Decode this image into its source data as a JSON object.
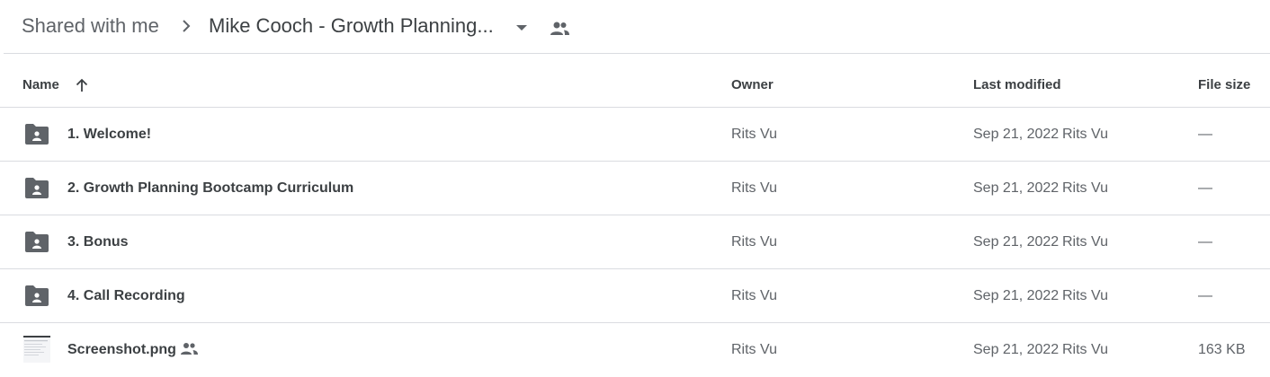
{
  "breadcrumb": {
    "root": "Shared with me",
    "current": "Mike Cooch - Growth Planning..."
  },
  "columns": {
    "name": "Name",
    "owner": "Owner",
    "last_modified": "Last modified",
    "file_size": "File size",
    "sort_direction": "ascending"
  },
  "files": [
    {
      "name": "1. Welcome!",
      "type": "shared-folder",
      "icon": "shared-folder-icon",
      "owner": "Rits Vu",
      "modified_date": "Sep 21, 2022",
      "modified_by": "Rits Vu",
      "size": "—"
    },
    {
      "name": "2. Growth Planning Bootcamp Curriculum",
      "type": "shared-folder",
      "icon": "shared-folder-icon",
      "owner": "Rits Vu",
      "modified_date": "Sep 21, 2022",
      "modified_by": "Rits Vu",
      "size": "—"
    },
    {
      "name": "3. Bonus",
      "type": "shared-folder",
      "icon": "shared-folder-icon",
      "owner": "Rits Vu",
      "modified_date": "Sep 21, 2022",
      "modified_by": "Rits Vu",
      "size": "—"
    },
    {
      "name": "4. Call Recording",
      "type": "shared-folder",
      "icon": "shared-folder-icon",
      "owner": "Rits Vu",
      "modified_date": "Sep 21, 2022",
      "modified_by": "Rits Vu",
      "size": "—"
    },
    {
      "name": "Screenshot.png",
      "type": "image",
      "icon": "image-thumbnail",
      "owner": "Rits Vu",
      "modified_date": "Sep 21, 2022",
      "modified_by": "Rits Vu",
      "size": "163 KB"
    }
  ],
  "colors": {
    "text_primary": "#3c4043",
    "text_secondary": "#5f6368",
    "divider": "#dadce0"
  }
}
